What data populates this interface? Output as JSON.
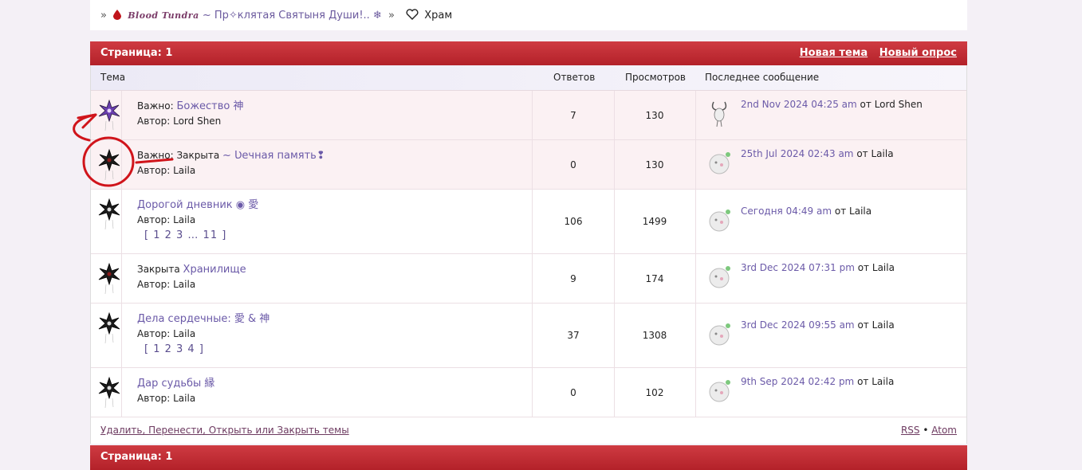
{
  "breadcrumb": {
    "sep": "»",
    "forum_brand": "Blood Tundra",
    "forum_title": "~ Пр✧клятая Святыня Души!.. ❄",
    "sep2": "»",
    "current": "Храм"
  },
  "top_bar": {
    "page_label": "Страница:",
    "page_num": "1",
    "new_topic": "Новая тема",
    "new_poll": "Новый опрос"
  },
  "bottom_bar": {
    "page_label": "Страница:",
    "page_num": "1"
  },
  "columns": {
    "topic": "Тема",
    "replies": "Ответов",
    "views": "Просмотров",
    "last_post": "Последнее сообщение"
  },
  "topics": [
    {
      "prefix": "Важно: ",
      "status": "",
      "title": "Божество 神",
      "author_label": "Автор:",
      "author": "Lord Shen",
      "pages": "",
      "replies": "7",
      "views": "130",
      "last_when": "2nd Nov 2024 04:25 am",
      "last_from": "от",
      "last_user": "Lord Shen"
    },
    {
      "prefix": "Важно: ",
      "status": "Закрыта ",
      "title": "~ Ʋечная память❢",
      "author_label": "Автор:",
      "author": "Laila",
      "pages": "",
      "replies": "0",
      "views": "130",
      "last_when": "25th Jul 2024 02:43 am",
      "last_from": "от",
      "last_user": "Laila"
    },
    {
      "prefix": "",
      "status": "",
      "title": "Дорогой дневник ◉ 愛",
      "author_label": "Автор:",
      "author": "Laila",
      "pages": "[ 1 2 3 … 11 ]",
      "replies": "106",
      "views": "1499",
      "last_when": "Сегодня 04:49 am",
      "last_from": "от",
      "last_user": "Laila"
    },
    {
      "prefix": "",
      "status": "Закрыта ",
      "title": "Хранилище",
      "author_label": "Автор:",
      "author": "Laila",
      "pages": "",
      "replies": "9",
      "views": "174",
      "last_when": "3rd Dec 2024 07:31 pm",
      "last_from": "от",
      "last_user": "Laila"
    },
    {
      "prefix": "",
      "status": "",
      "title": "Дела сердечные: 愛 & 神",
      "author_label": "Автор:",
      "author": "Laila",
      "pages": "[ 1 2 3 4 ]",
      "replies": "37",
      "views": "1308",
      "last_when": "3rd Dec 2024 09:55 am",
      "last_from": "от",
      "last_user": "Laila"
    },
    {
      "prefix": "",
      "status": "",
      "title": "Дар судьбы 縁",
      "author_label": "Автор:",
      "author": "Laila",
      "pages": "",
      "replies": "0",
      "views": "102",
      "last_when": "9th Sep 2024 02:42 pm",
      "last_from": "от",
      "last_user": "Laila"
    }
  ],
  "footer": {
    "moderation": "Удалить, Перенести, Открыть или Закрыть темы",
    "rss": "RSS",
    "dot": "•",
    "atom": "Atom"
  },
  "colors": {
    "accent": "#c0292f",
    "link": "#6b5aa8",
    "annotation": "#d0141b"
  }
}
